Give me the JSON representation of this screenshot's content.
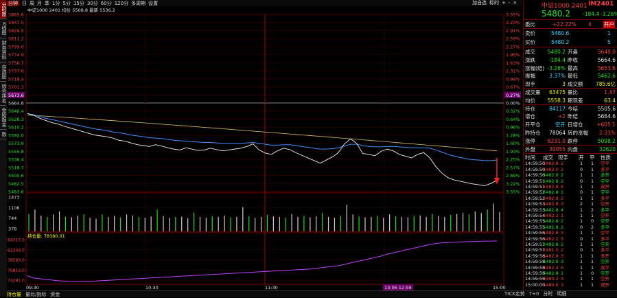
{
  "sidebar": {
    "tabs": [
      "分时图",
      "K线图",
      "财务资料",
      "自选股",
      "综合排名",
      "金股掘金",
      "数"
    ]
  },
  "toolbar": {
    "items": [
      "分钟",
      "日",
      "周",
      "月",
      "季",
      "1分",
      "5分",
      "15分",
      "30分",
      "60分",
      "120分",
      "多周期",
      "设置"
    ],
    "right": [
      "加自选",
      "标的",
      "+",
      "-",
      "×"
    ]
  },
  "chart": {
    "title": "中证1000 2401",
    "avg_label": "均价",
    "avg_value": "5508.8",
    "latest_label": "最新",
    "latest_value": "5536.2",
    "price_labels": [
      {
        "v": "5865.6",
        "c": "red"
      },
      {
        "v": "5847.5",
        "c": "red"
      },
      {
        "v": "5829.5",
        "c": "red"
      },
      {
        "v": "5811.2",
        "c": "red"
      },
      {
        "v": "5793.0",
        "c": "red"
      },
      {
        "v": "5774.9",
        "c": "red"
      },
      {
        "v": "5756.7",
        "c": "red"
      },
      {
        "v": "5737.6",
        "c": "red"
      },
      {
        "v": "5719.4",
        "c": "red"
      },
      {
        "v": "5701.3",
        "c": "red"
      },
      {
        "v": "5673.6",
        "c": "hi"
      },
      {
        "v": "5664.6",
        "c": "white"
      },
      {
        "v": "5646.4",
        "c": "green"
      },
      {
        "v": "5628.3",
        "c": "green"
      },
      {
        "v": "5610.2",
        "c": "green"
      },
      {
        "v": "5592.0",
        "c": "green"
      },
      {
        "v": "5573.9",
        "c": "green"
      },
      {
        "v": "5555.8",
        "c": "green"
      },
      {
        "v": "5536.4",
        "c": "green"
      },
      {
        "v": "5518.7",
        "c": "green"
      },
      {
        "v": "5500.6",
        "c": "green"
      },
      {
        "v": "5482.5",
        "c": "green"
      },
      {
        "v": "5463.6",
        "c": "green"
      }
    ],
    "pct_labels": [
      "3.55%",
      "3.23%",
      "2.91%",
      "2.59%",
      "2.27%",
      "1.95%",
      "1.63%",
      "1.31%",
      "0.99%",
      "0.67%",
      "0.27%",
      "0.00%",
      "0.32%",
      "0.64%",
      "0.96%",
      "1.28%",
      "1.60%",
      "1.93%",
      "2.25%",
      "2.57%",
      "2.89%",
      "3.22%",
      "3.55%"
    ],
    "vol_labels": [
      "1473",
      "1106",
      "744",
      "378"
    ],
    "oi_labels": [
      "84317.0",
      "82249.0",
      "78583.0",
      "76853.0",
      "74281.0"
    ],
    "oi_title": "持仓量",
    "oi_value": "78380.01",
    "time_labels": [
      "09:30",
      "10:30",
      "11:30",
      "13:06 12:59",
      "15:00"
    ],
    "line_white": [
      5641,
      5637,
      5630,
      5625,
      5620,
      5617,
      5612,
      5608,
      5604,
      5600,
      5596,
      5592,
      5590,
      5588,
      5585,
      5580,
      5578,
      5574,
      5570,
      5568,
      5566,
      5570,
      5567,
      5563,
      5560,
      5558,
      5563,
      5560,
      5557,
      5558,
      5562,
      5559,
      5556,
      5558,
      5560,
      5562,
      5566,
      5572,
      5558,
      5551,
      5548,
      5556,
      5562,
      5559,
      5552,
      5546,
      5540,
      5534,
      5528,
      5535,
      5542,
      5552,
      5572,
      5583,
      5573,
      5550,
      5548,
      5545,
      5555,
      5560,
      5556,
      5548,
      5544,
      5540,
      5548,
      5552,
      5540,
      5520,
      5505,
      5495,
      5490,
      5487,
      5484,
      5481,
      5479,
      5477,
      5482,
      5489
    ],
    "line_blue": [
      5640,
      5638,
      5634,
      5630,
      5627,
      5624,
      5621,
      5618,
      5615,
      5612,
      5609,
      5606,
      5604,
      5602,
      5599,
      5597,
      5595,
      5592,
      5590,
      5588,
      5586,
      5585,
      5584,
      5582,
      5580,
      5579,
      5578,
      5577,
      5576,
      5575,
      5575,
      5574,
      5573,
      5573,
      5573,
      5573,
      5574,
      5575,
      5573,
      5571,
      5569,
      5569,
      5570,
      5570,
      5568,
      5566,
      5564,
      5562,
      5560,
      5560,
      5561,
      5563,
      5567,
      5571,
      5571,
      5568,
      5566,
      5565,
      5565,
      5566,
      5566,
      5565,
      5564,
      5563,
      5563,
      5563,
      5562,
      5558,
      5553,
      5548,
      5544,
      5541,
      5538,
      5536,
      5535,
      5534,
      5534,
      5535
    ],
    "line_yellow_start": 5637,
    "line_yellow_end": 5556,
    "vol": [
      720,
      900,
      650,
      600,
      700,
      820,
      610,
      580,
      650,
      700,
      560,
      520,
      700,
      600,
      640,
      580,
      700,
      660,
      600,
      560,
      620,
      900,
      640,
      560,
      590,
      610,
      540,
      780,
      600,
      560,
      620,
      600,
      650,
      580,
      600,
      1000,
      620,
      560,
      600,
      680,
      620,
      600,
      560,
      720,
      600,
      640,
      580,
      620,
      760,
      600,
      560,
      640,
      1100,
      700,
      620,
      580,
      600,
      640,
      560,
      700,
      620,
      600,
      580,
      640,
      660,
      600,
      720,
      640,
      600,
      680,
      720,
      760,
      700,
      820,
      760,
      900,
      1150,
      800
    ],
    "oi": [
      83500,
      83800,
      83900,
      84000,
      84100,
      84200,
      84250,
      84300,
      84317,
      84300,
      84280,
      84250,
      84200,
      84150,
      84100,
      84050,
      84000,
      83950,
      83900,
      83850,
      83800,
      83750,
      83700,
      83650,
      83600,
      83550,
      83500,
      83450,
      83400,
      83350,
      83300,
      83250,
      83200,
      83150,
      83100,
      83050,
      83000,
      82950,
      82900,
      82850,
      82800,
      82750,
      82700,
      82650,
      82600,
      82550,
      82500,
      82450,
      82300,
      82200,
      82100,
      82000,
      81800,
      81600,
      81400,
      81200,
      81000,
      80800,
      80600,
      80300,
      80100,
      79900,
      79700,
      79500,
      79300,
      79100,
      78900,
      78750,
      78650,
      78600,
      78550,
      78500,
      78480,
      78450,
      78420,
      78400,
      78390,
      78380
    ]
  },
  "quote": {
    "name": "中证1000 2401",
    "code": "IM2401",
    "price": "5480.2",
    "change": "-184.4",
    "pct": "-3.26%",
    "weibi_label": "委比",
    "weibi": "+22.22%",
    "weicha": "4",
    "open_badge": "开户",
    "sell_label": "卖价",
    "sell": "5480.6",
    "sell_v": "1",
    "buy_label": "买价",
    "buy": "5480.2",
    "buy_v": "5",
    "rows": [
      [
        "成交",
        "5480.2",
        "开盘",
        "5649.0"
      ],
      [
        "涨跌",
        "-184.4",
        "昨收",
        "5664.6"
      ],
      [
        "涨幅(结)",
        "-3.26%",
        "最高",
        "5653.6"
      ],
      [
        "振幅",
        "3.37%",
        "最低",
        "5462.6"
      ],
      [
        "现手",
        "3",
        "成交额",
        "785.6亿"
      ],
      [
        "成交量",
        "63475",
        "量比",
        "1.47"
      ],
      [
        "均价",
        "5558.3",
        "期现差",
        "63.4"
      ],
      [
        "持仓",
        "84117",
        "今结",
        "5505.6"
      ],
      [
        "增仓",
        "+2",
        "昨结",
        "5664.6"
      ],
      [
        "开平仓",
        "空开",
        "日增仓",
        "+605.1"
      ],
      [
        "昨持仓",
        "78064",
        "转的涨幅",
        "2.33%"
      ],
      [
        "涨停",
        "6231.0",
        "跌停",
        "5098.2"
      ],
      [
        "外盘",
        "30055",
        "内盘",
        "32620"
      ]
    ],
    "tick_header": [
      "时间",
      "成交",
      "现手",
      "开",
      "平",
      "性质"
    ],
    "ticks": [
      [
        "14:59:50",
        "5482.8",
        "2",
        "1",
        "1",
        "空平"
      ],
      [
        "14:59:50",
        "5483.0",
        "2",
        "0",
        "1",
        "多平"
      ],
      [
        "14:59:50",
        "5482.8",
        "2",
        "1",
        "1",
        "多开"
      ],
      [
        "14:59:51",
        "5482.8",
        "2",
        "0",
        "1",
        "空平"
      ],
      [
        "14:59:51",
        "5482.8",
        "6",
        "1",
        "1",
        "双开"
      ],
      [
        "14:59:52",
        "5482.8",
        "1",
        "0",
        "1",
        "空平"
      ],
      [
        "14:59:52",
        "5482.8",
        "2",
        "1",
        "1",
        "多平"
      ],
      [
        "14:59:53",
        "5482.8",
        "3",
        "2",
        "1",
        "空开"
      ],
      [
        "14:59:53",
        "5482.8",
        "4",
        "1",
        "2",
        "多平"
      ],
      [
        "14:59:54",
        "5482.2",
        "1",
        "1",
        "1",
        "空开"
      ],
      [
        "14:59:55",
        "5482.8",
        "2",
        "1",
        "0",
        "空开"
      ],
      [
        "14:59:55",
        "5482.8",
        "2",
        "0",
        "2",
        "多平"
      ],
      [
        "14:59:56",
        "5482.6",
        "3",
        "1",
        "1",
        "空平"
      ],
      [
        "14:59:56",
        "5482.2",
        "3",
        "0",
        "1",
        "多平"
      ],
      [
        "14:59:57",
        "5482.8",
        "2",
        "1",
        "1",
        "空开"
      ],
      [
        "14:59:57",
        "5481.0",
        "2",
        "0",
        "1",
        "多平"
      ],
      [
        "14:59:58",
        "5482.8",
        "3",
        "1",
        "1",
        "多开"
      ],
      [
        "14:59:58",
        "5482.8",
        "3",
        "1",
        "1",
        "空开"
      ],
      [
        "14:59:58",
        "5482.4",
        "6",
        "1",
        "1",
        "双平"
      ],
      [
        "14:59:59",
        "5482.8",
        "1",
        "1",
        "0",
        "空开"
      ],
      [
        "14:59:59",
        "5480.2",
        "3",
        "1",
        "1",
        "空开"
      ],
      [
        "15:00:00",
        "5480.6",
        "3",
        "1",
        "1",
        "双开"
      ]
    ],
    "tick_colors": [
      "red",
      "red",
      "green",
      "green",
      "red",
      "green",
      "red",
      "red",
      "green",
      "red",
      "green",
      "green",
      "red",
      "red",
      "green",
      "red",
      "red",
      "green",
      "red",
      "green",
      "red",
      "red"
    ]
  },
  "bottom": {
    "tabs": [
      "持仓量",
      "量比/指标",
      "资金"
    ],
    "right": [
      "TICK走势",
      "T+0",
      "分时",
      "明细"
    ]
  }
}
